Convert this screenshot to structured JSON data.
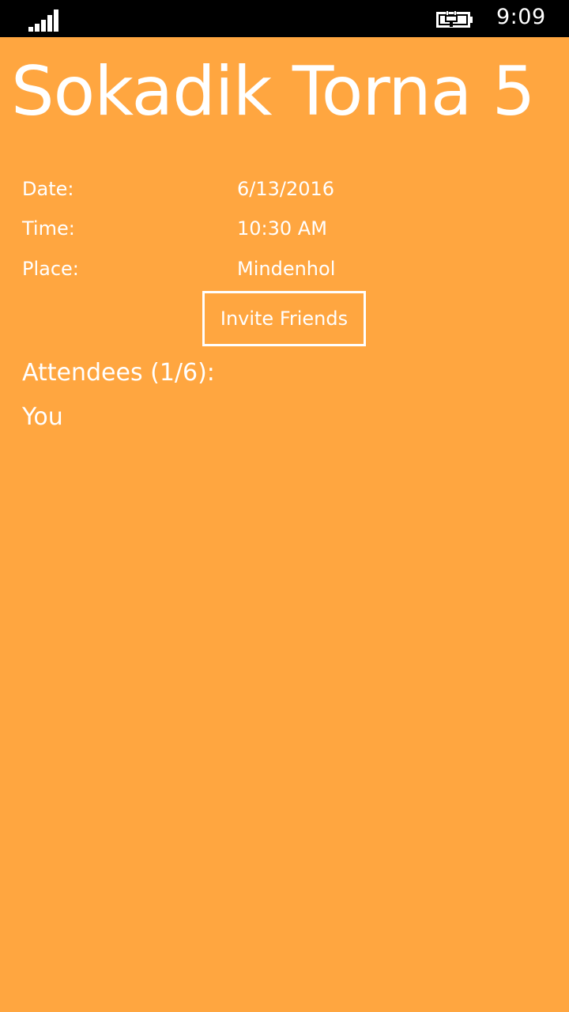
{
  "status_bar": {
    "time": "9:09",
    "signal_icon": "signal-strength-icon",
    "battery_icon": "battery-charging-icon"
  },
  "event": {
    "title": "Sokadik Torna 5",
    "details": {
      "date_label": "Date:",
      "date_value": "6/13/2016",
      "time_label": "Time:",
      "time_value": "10:30 AM",
      "place_label": "Place:",
      "place_value": "Mindenhol"
    },
    "invite_button_label": "Invite Friends",
    "attendees_heading": "Attendees (1/6):",
    "attendees": [
      "You"
    ]
  },
  "colors": {
    "background": "#ffa640",
    "status_bar": "#000000",
    "text": "#ffffff"
  }
}
